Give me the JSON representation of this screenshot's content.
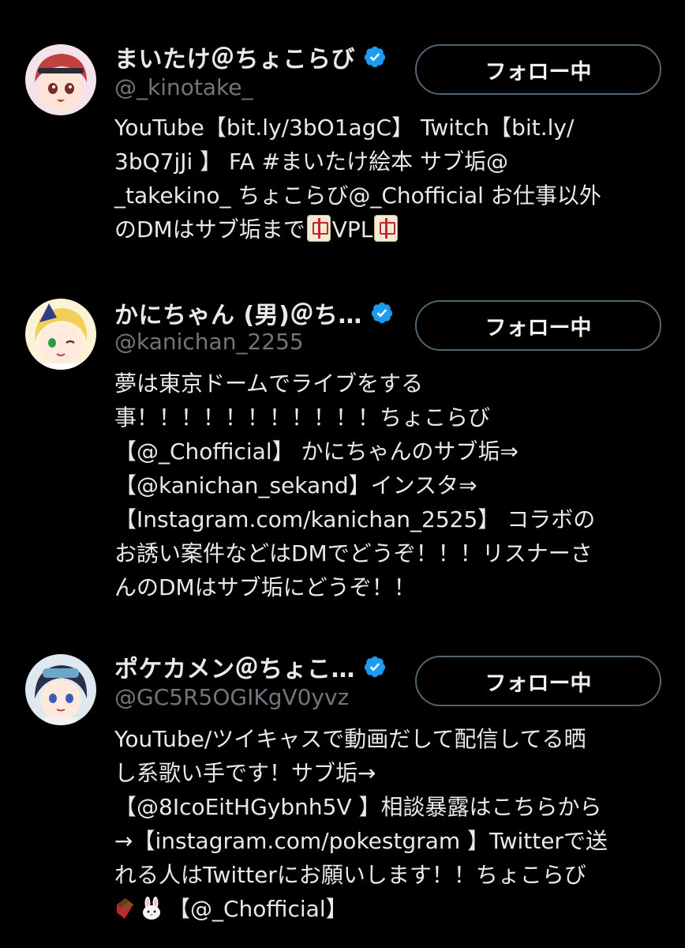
{
  "users": [
    {
      "display_name": "まいたけ＠ちょこらび",
      "handle": "@_kinotake_",
      "follow_label": "フォロー中",
      "bio_lines": [
        "YouTube【bit.ly/3bO1agC】 Twitch【bit.ly/",
        "3bQ7jJi 】 FA #まいたけ絵本 サブ垢@",
        "_takekino_ ちょこらび@_Chofficial お仕事以外"
      ],
      "bio_last_line_start": "のDMはサブ垢まで",
      "bio_last_line_mid": "VPL",
      "emoji": "mahjong-red-dragon"
    },
    {
      "display_name": "かにちゃん (男)＠ち…",
      "handle": "@kanichan_2255",
      "follow_label": "フォロー中",
      "bio_lines": [
        "夢は東京ドームでライブをする",
        "事！！！！！！！！！！！ちょこらび",
        "【@_Chofficial】 かにちゃんのサブ垢⇒",
        "【@kanichan_sekand】インスタ⇒",
        "【Instagram.com/kanichan_2525】 コラボの",
        "お誘い案件などはDMでどうぞ！！！リスナーさ",
        "んのDMはサブ垢にどうぞ！！"
      ]
    },
    {
      "display_name": "ポケカメン＠ちょこ…",
      "handle": "@GC5R5OGIKgV0yvz",
      "follow_label": "フォロー中",
      "bio_lines": [
        "YouTube/ツイキャスで動画だして配信してる晒",
        "し系歌い手です！サブ垢→",
        "【@8IcoEitHGybnh5V 】相談暴露はこちらから",
        "→【instagram.com/pokestgram 】Twitterで送",
        "れる人はTwitterにお願いします！！ちょこらび"
      ],
      "bio_last_line_end": "【@_Chofficial】",
      "emojis": [
        "chocolate-bar",
        "rabbit-face"
      ]
    }
  ],
  "colors": {
    "background": "#000000",
    "text": "#e7e9ea",
    "secondary_text": "#71767b",
    "verified_blue": "#1d9bf0",
    "button_border": "#536471"
  }
}
